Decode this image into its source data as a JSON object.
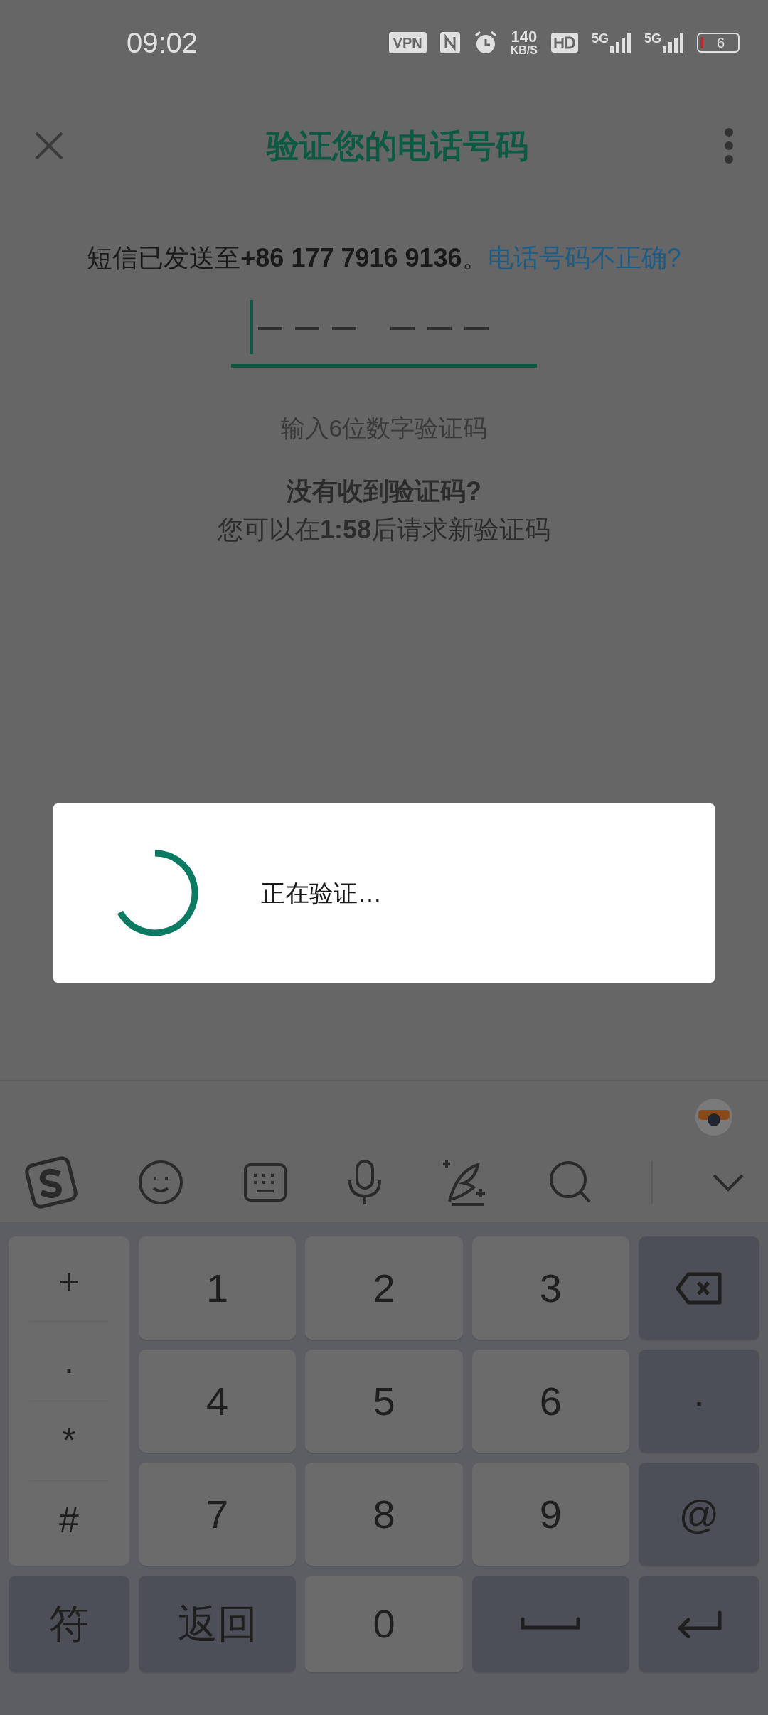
{
  "status_bar": {
    "time": "09:02",
    "vpn": "VPN",
    "speed_value": "140",
    "speed_unit": "KB/S",
    "networks": [
      "5G",
      "5G"
    ],
    "battery": "6"
  },
  "header": {
    "title": "验证您的电话号码"
  },
  "message": {
    "text": "短信已发送至**+86 177 7916 9136**。",
    "link": "电话号码不正确?"
  },
  "hint": "输入6位数字验证码",
  "resend": {
    "title": "没有收到验证码?",
    "text": "您可以在**1:58**后请求新验证码"
  },
  "dialog": {
    "text": "正在验证…"
  },
  "keyboard": {
    "symbols": [
      "+",
      ".",
      "*",
      "#"
    ],
    "rows": [
      [
        {
          "kind": "digit",
          "label": "1"
        },
        {
          "kind": "digit",
          "label": "2"
        },
        {
          "kind": "digit",
          "label": "3"
        },
        {
          "kind": "backspace"
        }
      ],
      [
        {
          "kind": "digit",
          "label": "4"
        },
        {
          "kind": "digit",
          "label": "5"
        },
        {
          "kind": "digit",
          "label": "6"
        },
        {
          "kind": "function",
          "label": "·"
        }
      ],
      [
        {
          "kind": "digit",
          "label": "7"
        },
        {
          "kind": "digit",
          "label": "8"
        },
        {
          "kind": "digit",
          "label": "9"
        },
        {
          "kind": "function",
          "label": "@"
        }
      ]
    ],
    "bottom_row": [
      {
        "kind": "function",
        "label": "符"
      },
      {
        "kind": "function",
        "label": "返回"
      },
      {
        "kind": "digit",
        "label": "0"
      },
      {
        "kind": "space"
      },
      {
        "kind": "enter"
      }
    ]
  }
}
